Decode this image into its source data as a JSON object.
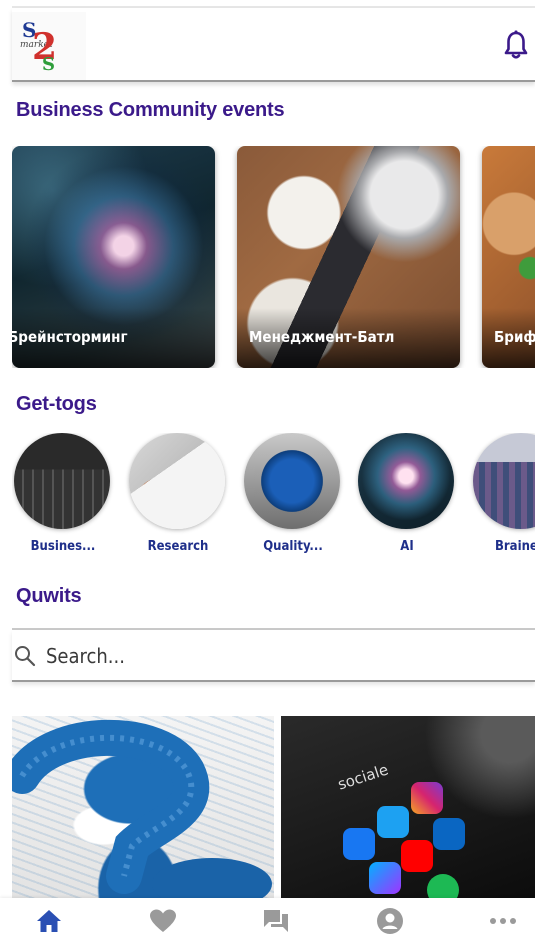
{
  "header": {
    "logo_text": [
      "S",
      "market",
      "2",
      "S"
    ],
    "notification_icon": "bell-icon"
  },
  "sections": {
    "events_title": "Business Community events",
    "togs_title": "Get-togs",
    "quwits_title": "Quwits"
  },
  "events": [
    {
      "label": "Брейнсторминг"
    },
    {
      "label": "Менеджмент-Батл"
    },
    {
      "label": "Бриф-"
    }
  ],
  "togs": [
    {
      "label": "Busines..."
    },
    {
      "label": "Research"
    },
    {
      "label": "Quality..."
    },
    {
      "label": "AI"
    },
    {
      "label": "Braines"
    }
  ],
  "search": {
    "placeholder": "Search..."
  },
  "quwits": [
    {
      "image": "question-mark-image"
    },
    {
      "image": "social-media-phone-image",
      "caption": "sociale"
    }
  ],
  "bottom_nav": [
    {
      "icon": "home-icon",
      "active": true
    },
    {
      "icon": "heart-icon"
    },
    {
      "icon": "chat-icon"
    },
    {
      "icon": "profile-icon"
    },
    {
      "icon": "more-icon"
    }
  ],
  "colors": {
    "accent": "#3b1a8a",
    "link": "#1f2f8a",
    "nav_active": "#2a4fb3",
    "nav_inactive": "#9a9a9a"
  }
}
